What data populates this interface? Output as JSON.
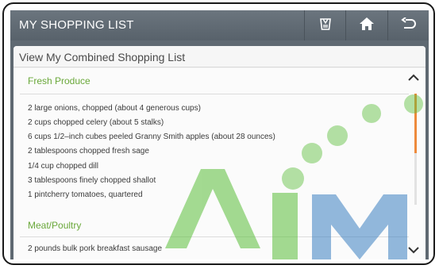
{
  "header": {
    "title": "MY SHOPPING LIST",
    "icons": [
      "cart-icon",
      "home-icon",
      "back-icon"
    ]
  },
  "panel": {
    "title": "View My Combined Shopping List"
  },
  "sections": [
    {
      "label": "Fresh Produce",
      "items": [
        "2 large onions, chopped (about 4 generous cups)",
        "2 cups chopped celery (about 5 stalks)",
        "6 cups 1/2–inch cubes peeled Granny Smith apples (about 28 ounces)",
        "2 tablespoons chopped fresh sage",
        "1/4 cup chopped dill",
        "3 tablespoons finely chopped shallot",
        "1 pintcherry tomatoes, quartered"
      ]
    },
    {
      "label": "Meat/Poultry",
      "items": [
        "2 pounds bulk pork breakfast sausage"
      ]
    }
  ],
  "colors": {
    "section_label": "#6aa83a",
    "scroll_thumb": "#ee8a3c",
    "topbar": "#5f6972"
  }
}
